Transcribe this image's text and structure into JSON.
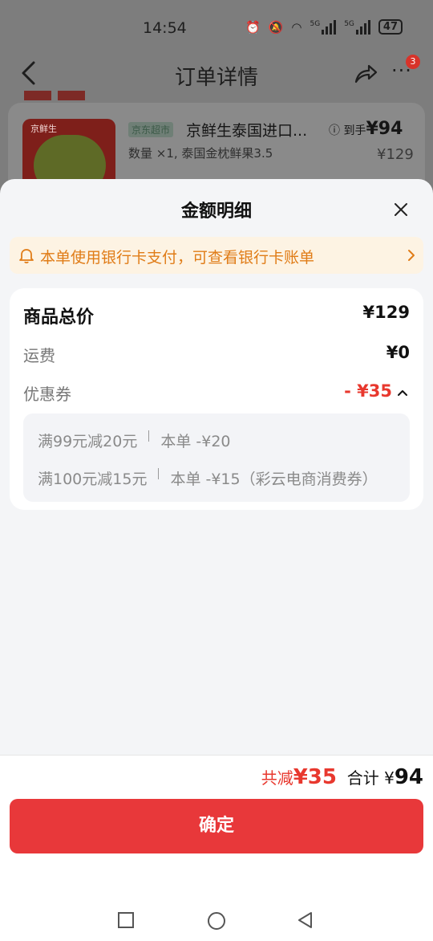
{
  "status_bar": {
    "time": "14:54",
    "network_1": "5G",
    "network_2": "5G",
    "battery": "47"
  },
  "nav": {
    "title": "订单详情",
    "badge_count": "3"
  },
  "product": {
    "image_label": "京鲜生",
    "market_tag": "京东超市",
    "title": "京鲜生泰国进口...",
    "spec": "数量 ×1, 泰国金枕鲜果3.5",
    "pay_prefix": "到手",
    "pay_price": "¥94",
    "original_price": "¥129"
  },
  "sheet": {
    "title": "金额明细",
    "notice": "本单使用银行卡支付，可查看银行卡账单",
    "rows": {
      "total_label": "商品总价",
      "total_value": "¥129",
      "shipping_label": "运费",
      "shipping_value": "¥0",
      "coupon_label": "优惠券",
      "coupon_value": "- ¥35"
    },
    "coupons": [
      {
        "rule": "满99元减20元",
        "detail": "本单 -¥20"
      },
      {
        "rule": "满100元减15元",
        "detail": "本单 -¥15（彩云电商消费券）"
      }
    ]
  },
  "footer": {
    "discount_label": "共减",
    "discount_value": "¥35",
    "total_label": "合计",
    "total_currency": "¥",
    "total_value": "94",
    "confirm": "确定"
  },
  "colors": {
    "accent": "#e8383a",
    "coupon_red": "#e8382e",
    "notice_orange": "#e07c17",
    "notice_bg": "#fdf3e3"
  }
}
